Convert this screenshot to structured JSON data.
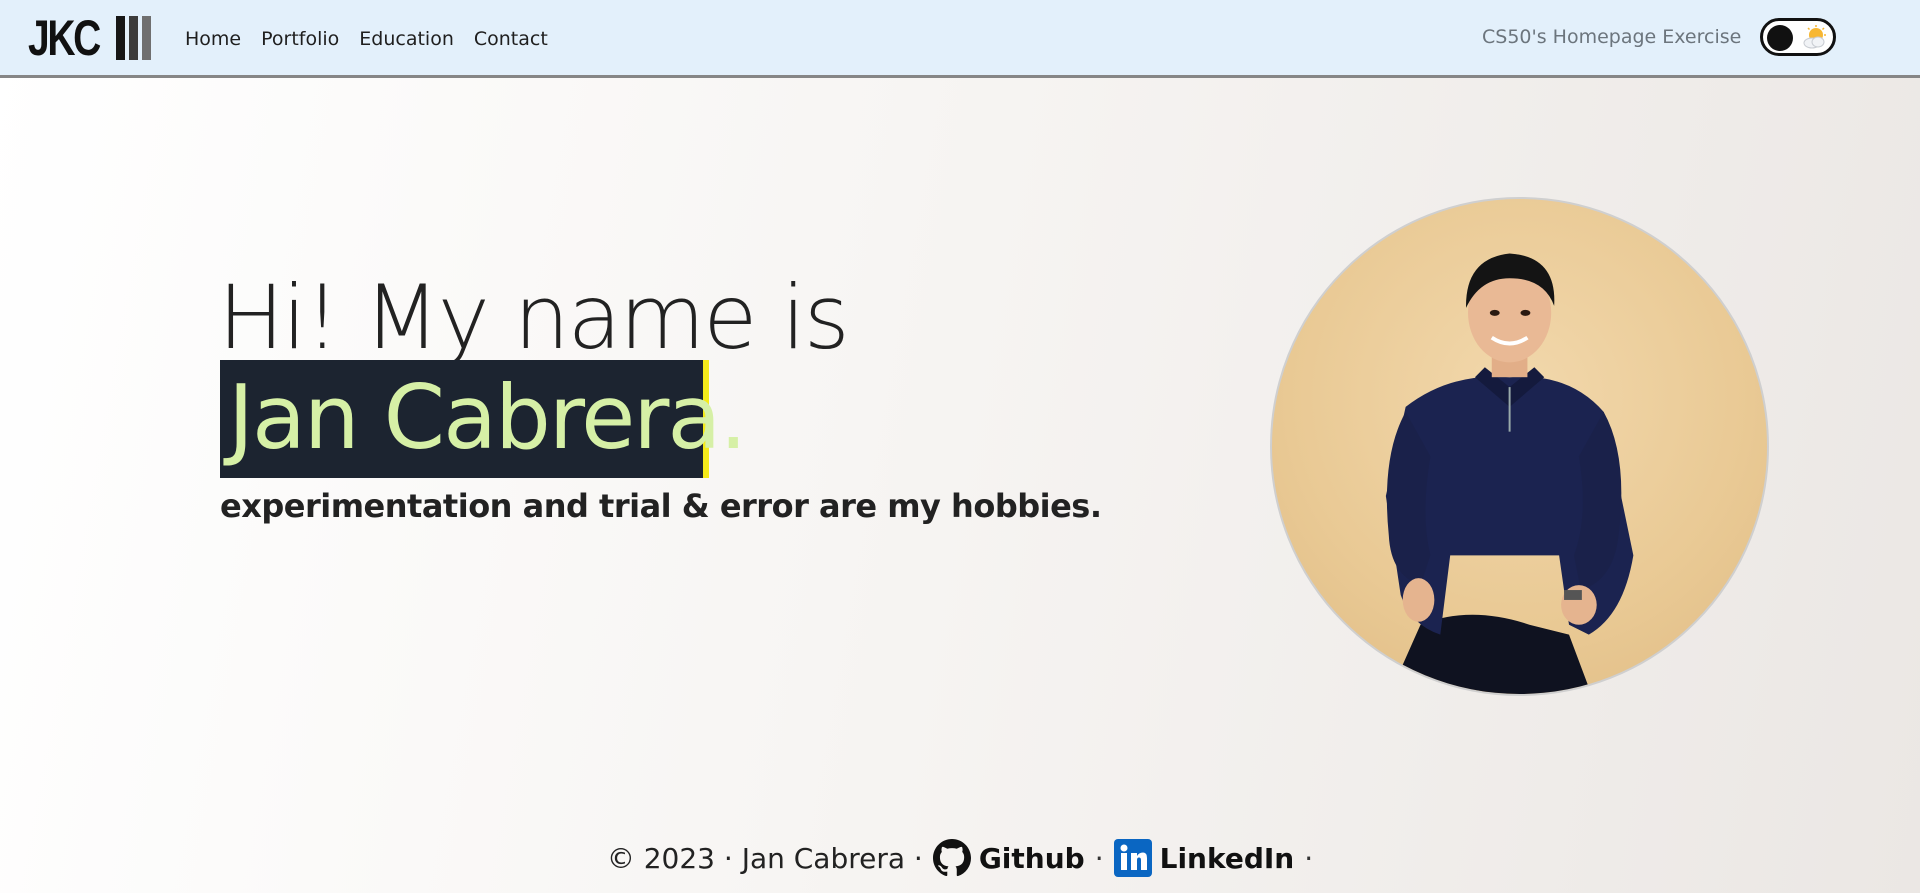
{
  "navbar": {
    "brand": "JKC",
    "links": [
      "Home",
      "Portfolio",
      "Education",
      "Contact"
    ],
    "right_text": "CS50's Homepage Exercise",
    "theme_toggle_icon": "sun-behind-cloud-icon"
  },
  "hero": {
    "greeting": "Hi! My name is",
    "name": "Jan Cabrera.",
    "tagline": "experimentation and trial & error are my hobbies."
  },
  "portrait": {
    "icon": "profile-photo"
  },
  "footer": {
    "copyright": "© 2023 · Jan Cabrera ·",
    "github_label": "Github",
    "github_icon": "github-icon",
    "sep": "·",
    "linkedin_label": "LinkedIn",
    "linkedin_icon": "linkedin-icon",
    "trailing": "·"
  },
  "colors": {
    "navbar_bg": "#e3f0fb",
    "name_bg": "#1c2430",
    "name_text": "#d6f0a6",
    "cursor": "#f4ea1a",
    "linkedin_blue": "#0a66c2"
  }
}
